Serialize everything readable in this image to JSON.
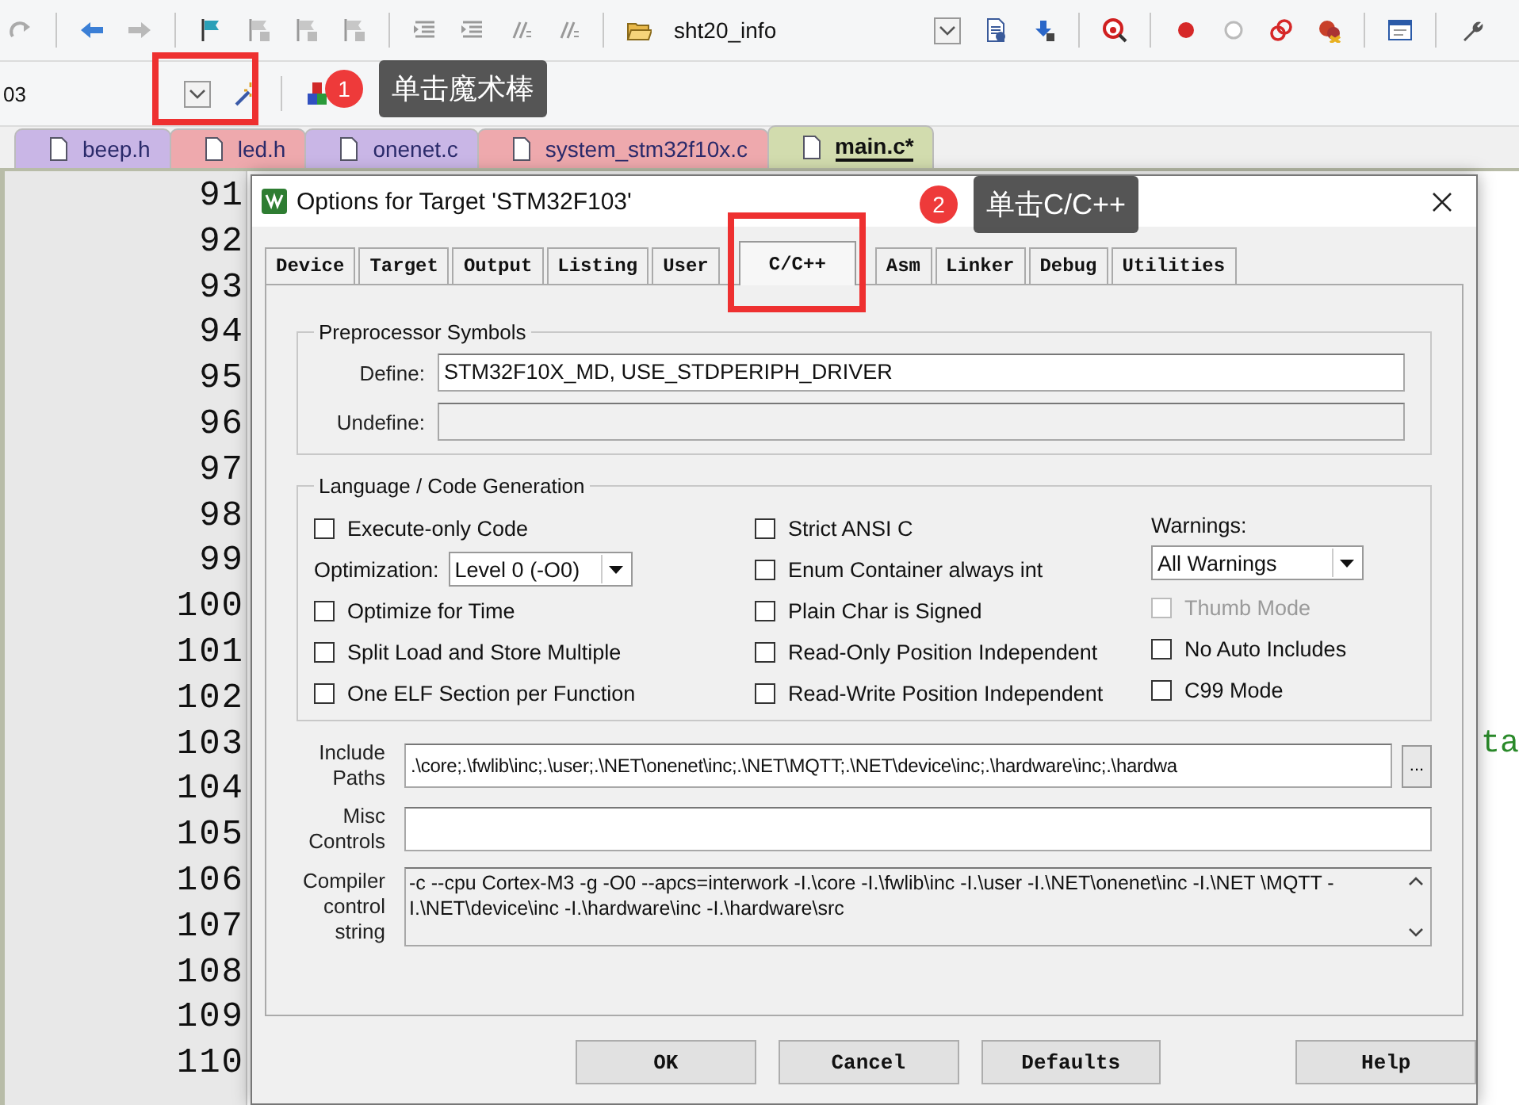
{
  "toolbar": {
    "find_value": "sht20_info",
    "target_value": "03"
  },
  "file_tabs": [
    {
      "label": "beep.h",
      "selected": false,
      "color": "#c9b6e6"
    },
    {
      "label": "led.h",
      "selected": false,
      "color": "#eea9ad"
    },
    {
      "label": "onenet.c",
      "selected": false,
      "color": "#c9b6e6"
    },
    {
      "label": "system_stm32f10x.c",
      "selected": false,
      "color": "#eea9ad"
    },
    {
      "label": "main.c*",
      "selected": true,
      "color": "#d2dcae"
    }
  ],
  "editor": {
    "lines": [
      {
        "number": "91"
      },
      {
        "number": "92"
      },
      {
        "number": "93"
      },
      {
        "number": "94"
      },
      {
        "number": "95"
      },
      {
        "number": "96"
      },
      {
        "number": "97"
      },
      {
        "number": "98"
      },
      {
        "number": "99"
      },
      {
        "number": "100"
      },
      {
        "number": "101"
      },
      {
        "number": "102"
      },
      {
        "number": "103",
        "code": "ta"
      },
      {
        "number": "104"
      },
      {
        "number": "105"
      },
      {
        "number": "106"
      },
      {
        "number": "107"
      },
      {
        "number": "108"
      },
      {
        "number": "109"
      },
      {
        "number": "110"
      }
    ]
  },
  "dialog": {
    "title": "Options for Target 'STM32F103'",
    "tabs": [
      {
        "label": "Device",
        "selected": false
      },
      {
        "label": "Target",
        "selected": false
      },
      {
        "label": "Output",
        "selected": false
      },
      {
        "label": "Listing",
        "selected": false
      },
      {
        "label": "User",
        "selected": false
      },
      {
        "label": "C/C++",
        "selected": true
      },
      {
        "label": "Asm",
        "selected": false
      },
      {
        "label": "Linker",
        "selected": false
      },
      {
        "label": "Debug",
        "selected": false
      },
      {
        "label": "Utilities",
        "selected": false
      }
    ],
    "preprocessor": {
      "title": "Preprocessor Symbols",
      "define_label": "Define:",
      "define_value": "STM32F10X_MD, USE_STDPERIPH_DRIVER",
      "undefine_label": "Undefine:",
      "undefine_disabled": true
    },
    "language": {
      "title": "Language / Code Generation",
      "columns": [
        [
          {
            "kind": "checkbox",
            "label": "Execute-only Code",
            "checked": false,
            "disabled": false
          },
          {
            "kind": "select",
            "label": "Optimization:",
            "value": "Level 0 (-O0)"
          },
          {
            "kind": "checkbox",
            "label": "Optimize for Time",
            "checked": false,
            "disabled": false
          },
          {
            "kind": "checkbox",
            "label": "Split Load and Store Multiple",
            "checked": false,
            "disabled": false
          },
          {
            "kind": "checkbox",
            "label": "One ELF Section per Function",
            "checked": false,
            "disabled": false
          }
        ],
        [
          {
            "kind": "checkbox",
            "label": "Strict ANSI C",
            "checked": false,
            "disabled": false
          },
          {
            "kind": "checkbox",
            "label": "Enum Container always int",
            "checked": false,
            "disabled": false
          },
          {
            "kind": "checkbox",
            "label": "Plain Char is Signed",
            "checked": false,
            "disabled": false
          },
          {
            "kind": "checkbox",
            "label": "Read-Only Position Independent",
            "checked": false,
            "disabled": false
          },
          {
            "kind": "checkbox",
            "label": "Read-Write Position Independent",
            "checked": false,
            "disabled": false
          }
        ],
        [
          {
            "kind": "label",
            "label": "Warnings:"
          },
          {
            "kind": "select",
            "value": "All Warnings"
          },
          {
            "kind": "checkbox",
            "label": "Thumb Mode",
            "checked": false,
            "disabled": true
          },
          {
            "kind": "checkbox",
            "label": "No Auto Includes",
            "checked": false,
            "disabled": false
          },
          {
            "kind": "checkbox",
            "label": "C99 Mode",
            "checked": false,
            "disabled": false
          }
        ]
      ]
    },
    "include_paths": {
      "label": "Include Paths",
      "value": ".\\core;.\\fwlib\\inc;.\\user;.\\NET\\onenet\\inc;.\\NET\\MQTT;.\\NET\\device\\inc;.\\hardware\\inc;.\\hardwa",
      "browse": "..."
    },
    "misc_controls": {
      "label": "Misc Controls"
    },
    "compiler_string": {
      "label": "Compiler control string",
      "value": "-c --cpu Cortex-M3 -g -O0 --apcs=interwork -I.\\core -I.\\fwlib\\inc -I.\\user -I.\\NET\\onenet\\inc -I.\\NET \\MQTT -I.\\NET\\device\\inc -I.\\hardware\\inc -I.\\hardware\\src"
    },
    "buttons": [
      "OK",
      "Cancel",
      "Defaults",
      "Help"
    ]
  },
  "annotations": [
    {
      "number": "1",
      "text": "单击魔术棒"
    },
    {
      "number": "2",
      "text": "单击C/C++"
    }
  ]
}
